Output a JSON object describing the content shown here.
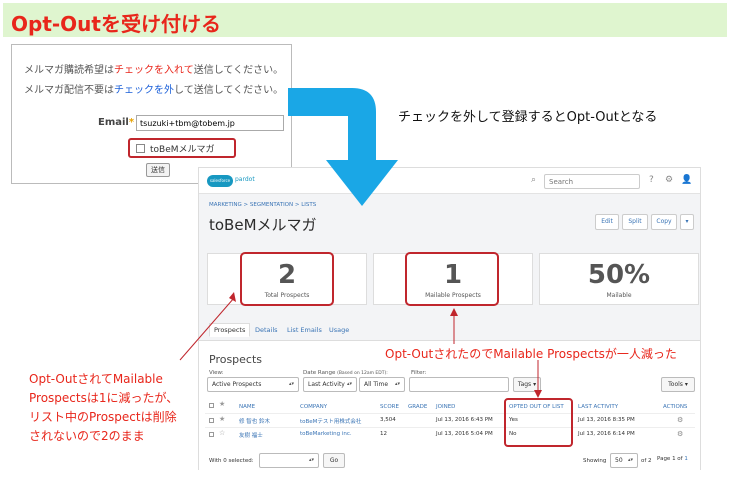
{
  "title": "Opt-Outを受け付ける",
  "form": {
    "line1": {
      "before": "メルマガ購読希望は",
      "highlight": "チェックを入れて",
      "after": "送信してください。"
    },
    "line2": {
      "before": "メルマガ配信不要は",
      "highlight": "チェックを外",
      "after": "して送信してください。"
    },
    "email_label": "Email",
    "email_value": "tsuzuki+tbm@tobem.jp",
    "checkbox_label": "toBeMメルマガ",
    "submit_label": "送信"
  },
  "callout_right": "チェックを外して登録するとOpt-Outとなる",
  "callout_mid": "Opt-OutされたのでMailable Prospectsが一人減った",
  "callout_left": [
    "Opt-OutされてMailable",
    "Prospectsは1に減ったが、",
    "リスト中のProspectは削除",
    "されないので2のまま"
  ],
  "pardot": {
    "logo": "salesforce",
    "logo_sub": "pardot",
    "search_placeholder": "Search",
    "help_icon": "?",
    "breadcrumb": "MARKETING > SEGMENTATION > LISTS",
    "page_title": "toBeMメルマガ",
    "buttons": {
      "edit": "Edit",
      "split": "Split",
      "copy": "Copy",
      "more": "▾"
    },
    "cards": [
      {
        "value": "2",
        "label": "Total Prospects"
      },
      {
        "value": "1",
        "label": "Mailable Prospects"
      },
      {
        "value": "50%",
        "label": "Mailable"
      }
    ],
    "tabs": [
      "Prospects",
      "Details",
      "List Emails",
      "Usage"
    ],
    "section_title": "Prospects",
    "filters": {
      "view_label": "View:",
      "view_value": "Active Prospects",
      "date_label": "Date Range",
      "date_note": "(Based on 12am EDT):",
      "date_value": "Last Activity",
      "time_value": "All Time",
      "filter_label": "Filter:",
      "tags_label": "Tags ▾",
      "tools_label": "Tools ▾"
    },
    "columns": [
      "NAME",
      "COMPANY",
      "SCORE",
      "GRADE",
      "JOINED",
      "OPTED OUT OF LIST",
      "LAST ACTIVITY",
      "ACTIONS"
    ],
    "rows": [
      {
        "name": "修 智也 鈴木",
        "company": "toBeMテスト用株式会社",
        "score": "3,504",
        "grade": "",
        "joined": "Jul 13, 2016 6:43 PM",
        "opted_out": "Yes",
        "last_activity": "Jul 13, 2016 8:35 PM"
      },
      {
        "name": "友樹 福士",
        "company": "toBeMarketing inc.",
        "score": "12",
        "grade": "",
        "joined": "Jul 13, 2016 5:04 PM",
        "opted_out": "No",
        "last_activity": "Jul 13, 2016 6:14 PM"
      }
    ],
    "footer": {
      "selected": "With 0 selected:",
      "go": "Go",
      "showing": "Showing",
      "per_page": "50",
      "of": "of 2",
      "page_label": "Page 1 of",
      "page_link": "1"
    }
  },
  "colors": {
    "accent_red": "#e8261b",
    "highlight_border": "#c0262d",
    "arrow_blue": "#1aa7e6",
    "title_bg": "#dff5cf"
  }
}
